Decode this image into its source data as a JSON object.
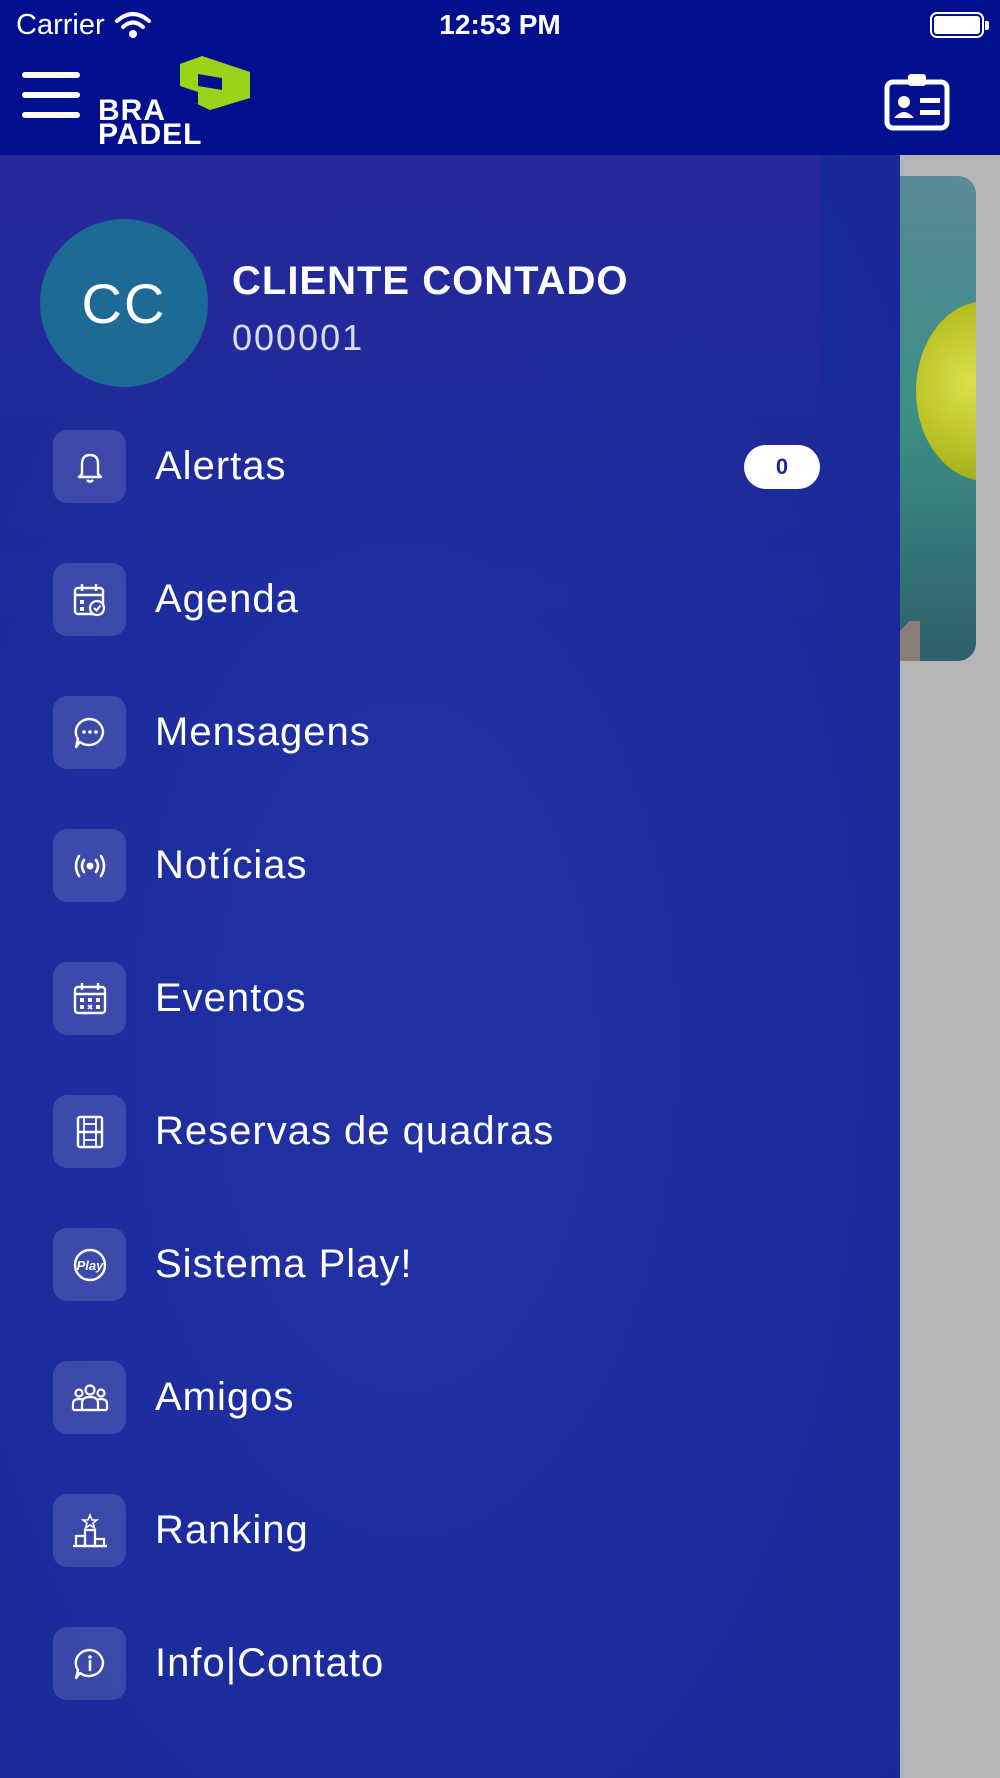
{
  "status_bar": {
    "carrier": "Carrier",
    "time": "12:53 PM"
  },
  "header": {
    "logo_line1": "BRA",
    "logo_line2": "PADEL",
    "logo_accent_color": "#9bd31a"
  },
  "profile": {
    "initials": "CC",
    "name": "CLIENTE CONTADO",
    "id": "000001"
  },
  "menu": {
    "items": [
      {
        "label": "Alertas",
        "icon": "bell-icon",
        "badge": "0"
      },
      {
        "label": "Agenda",
        "icon": "calendar-check-icon"
      },
      {
        "label": "Mensagens",
        "icon": "chat-bubble-icon"
      },
      {
        "label": "Notícias",
        "icon": "broadcast-icon"
      },
      {
        "label": "Eventos",
        "icon": "calendar-grid-icon"
      },
      {
        "label": "Reservas de quadras",
        "icon": "court-icon"
      },
      {
        "label": "Sistema Play!",
        "icon": "play-badge-icon"
      },
      {
        "label": "Amigos",
        "icon": "friends-icon"
      },
      {
        "label": "Ranking",
        "icon": "podium-icon"
      },
      {
        "label": "Info|Contato",
        "icon": "info-chat-icon"
      }
    ]
  },
  "colors": {
    "nav_background": "#020f8e",
    "drawer_background": "#1d2d9f",
    "avatar_background": "#1e6a97"
  }
}
